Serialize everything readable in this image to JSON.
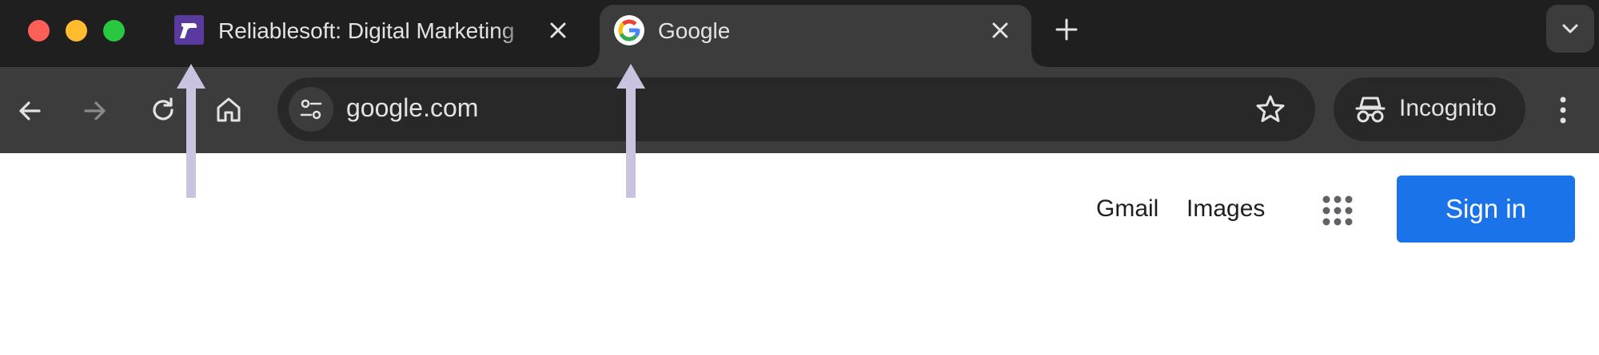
{
  "browser": {
    "tabs": [
      {
        "title": "Reliablesoft: Digital Marketing",
        "favicon": "reliablesoft-icon",
        "active": false
      },
      {
        "title": "Google",
        "favicon": "google-icon",
        "active": true
      }
    ],
    "address_bar": {
      "url": "google.com"
    },
    "profile": {
      "label": "Incognito"
    }
  },
  "page": {
    "header_links": {
      "gmail": "Gmail",
      "images": "Images"
    },
    "sign_in_label": "Sign in"
  },
  "colors": {
    "tabstrip_bg": "#1f1f1f",
    "toolbar_bg": "#3c3c3c",
    "signin_blue": "#1a73e8",
    "annotation_arrow": "#c9c3e0"
  }
}
